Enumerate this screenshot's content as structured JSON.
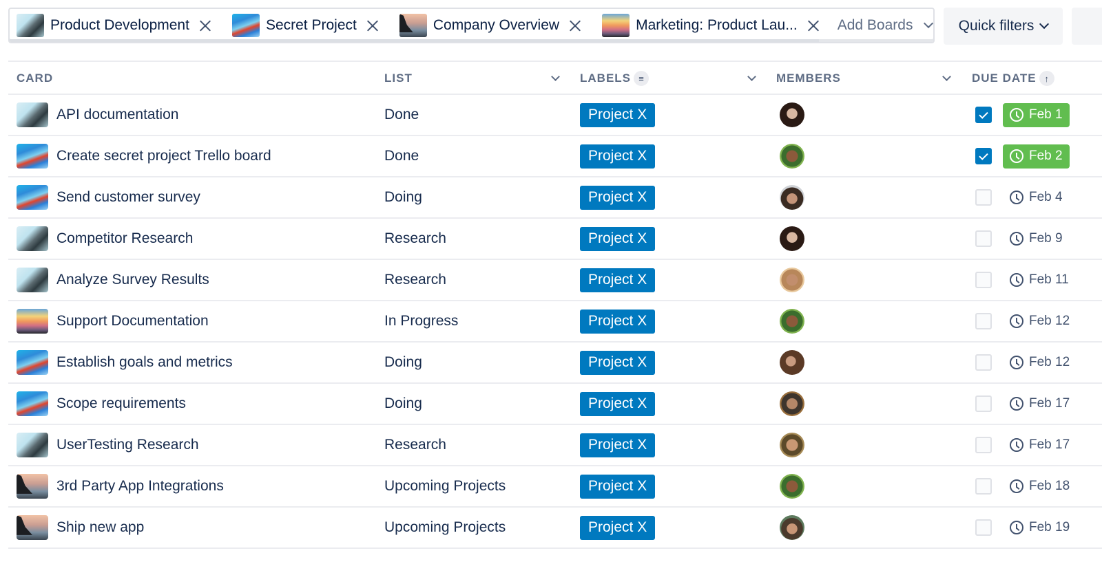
{
  "boards": [
    {
      "name": "Product Development",
      "thumb": "bridge"
    },
    {
      "name": "Secret Project",
      "thumb": "paint"
    },
    {
      "name": "Company Overview",
      "thumb": "coast"
    },
    {
      "name": "Marketing: Product Lau...",
      "thumb": "sunset"
    }
  ],
  "toolbar": {
    "add_boards_label": "Add Boards",
    "quick_filters_label": "Quick filters"
  },
  "columns": {
    "card": "CARD",
    "list": "LIST",
    "labels": "LABELS",
    "members": "MEMBERS",
    "due_date": "DUE DATE",
    "labels_filter_icon": "filter-icon",
    "due_sort_icon": "arrow-up-icon"
  },
  "colors": {
    "label_blue": "#0079bf",
    "due_complete_green": "#61bd4f",
    "checkbox_checked": "#0079bf"
  },
  "rows": [
    {
      "title": "API documentation",
      "thumb": "bridge",
      "list": "Done",
      "label": "Project X",
      "member": "av-1",
      "done": true,
      "due": "Feb 1"
    },
    {
      "title": "Create secret project Trello board",
      "thumb": "paint",
      "list": "Done",
      "label": "Project X",
      "member": "av-2",
      "done": true,
      "due": "Feb 2"
    },
    {
      "title": "Send customer survey",
      "thumb": "paint",
      "list": "Doing",
      "label": "Project X",
      "member": "av-3",
      "done": false,
      "due": "Feb 4"
    },
    {
      "title": "Competitor Research",
      "thumb": "bridge",
      "list": "Research",
      "label": "Project X",
      "member": "av-1",
      "done": false,
      "due": "Feb 9"
    },
    {
      "title": "Analyze Survey Results",
      "thumb": "bridge",
      "list": "Research",
      "label": "Project X",
      "member": "av-4",
      "done": false,
      "due": "Feb 11"
    },
    {
      "title": "Support Documentation",
      "thumb": "sunset",
      "list": "In Progress",
      "label": "Project X",
      "member": "av-2",
      "done": false,
      "due": "Feb 12"
    },
    {
      "title": "Establish goals and metrics",
      "thumb": "paint",
      "list": "Doing",
      "label": "Project X",
      "member": "av-5",
      "done": false,
      "due": "Feb 12"
    },
    {
      "title": "Scope requirements",
      "thumb": "paint",
      "list": "Doing",
      "label": "Project X",
      "member": "av-6",
      "done": false,
      "due": "Feb 17"
    },
    {
      "title": "UserTesting Research",
      "thumb": "bridge",
      "list": "Research",
      "label": "Project X",
      "member": "av-7",
      "done": false,
      "due": "Feb 17"
    },
    {
      "title": "3rd Party App Integrations",
      "thumb": "coast",
      "list": "Upcoming Projects",
      "label": "Project X",
      "member": "av-2",
      "done": false,
      "due": "Feb 18"
    },
    {
      "title": "Ship new app",
      "thumb": "coast",
      "list": "Upcoming Projects",
      "label": "Project X",
      "member": "av-8",
      "done": false,
      "due": "Feb 19"
    }
  ]
}
